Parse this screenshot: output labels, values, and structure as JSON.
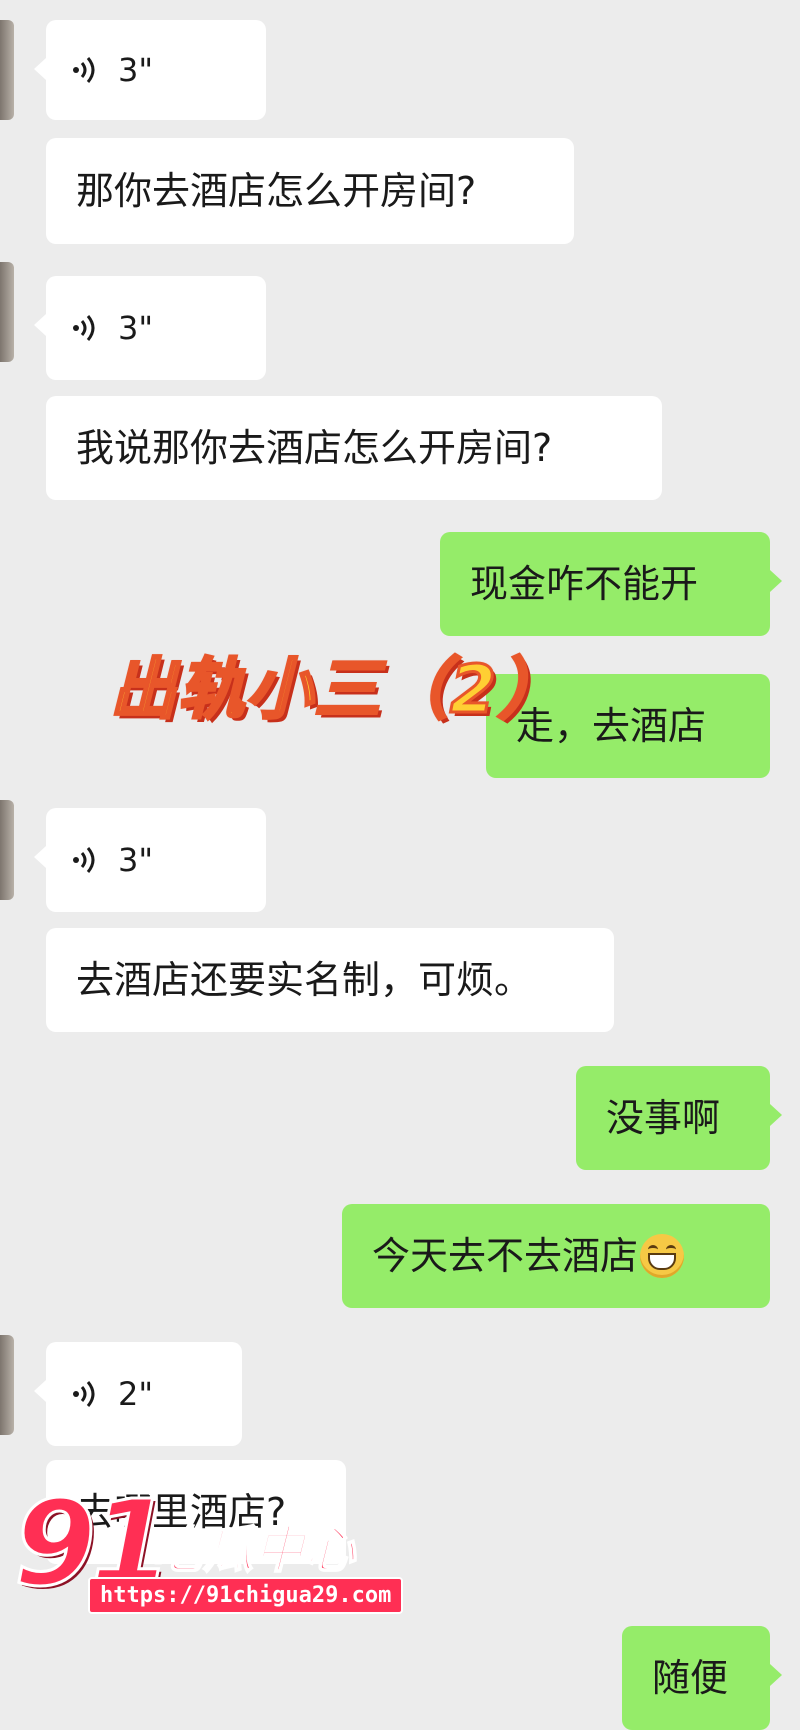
{
  "messages": [
    {
      "type": "voice",
      "from": "other",
      "duration": "3\""
    },
    {
      "type": "text",
      "from": "other",
      "text": "那你去酒店怎么开房间?"
    },
    {
      "type": "voice",
      "from": "other",
      "duration": "3\""
    },
    {
      "type": "text",
      "from": "other",
      "text": "我说那你去酒店怎么开房间?"
    },
    {
      "type": "text",
      "from": "me",
      "text": "现金咋不能开"
    },
    {
      "type": "text",
      "from": "me",
      "text": "走，去酒店"
    },
    {
      "type": "voice",
      "from": "other",
      "duration": "3\""
    },
    {
      "type": "text",
      "from": "other",
      "text": "去酒店还要实名制，可烦。"
    },
    {
      "type": "text",
      "from": "me",
      "text": "没事啊"
    },
    {
      "type": "text",
      "from": "me",
      "text": "今天去不去酒店",
      "emoji": "grinning-face-emoji"
    },
    {
      "type": "voice",
      "from": "other",
      "duration": "2\""
    },
    {
      "type": "text",
      "from": "other",
      "text": "去哪里酒店?"
    },
    {
      "type": "text",
      "from": "me",
      "text": "随便"
    }
  ],
  "overlay": {
    "title": "出轨小三（2）",
    "color": "#ffcf33"
  },
  "watermark": {
    "number": "91",
    "name": "吃瓜中心",
    "url": "https://91chigua29.com",
    "color": "#ff2f54"
  },
  "colors": {
    "background": "#ececec",
    "incoming_bubble": "#ffffff",
    "outgoing_bubble": "#95ec69"
  }
}
